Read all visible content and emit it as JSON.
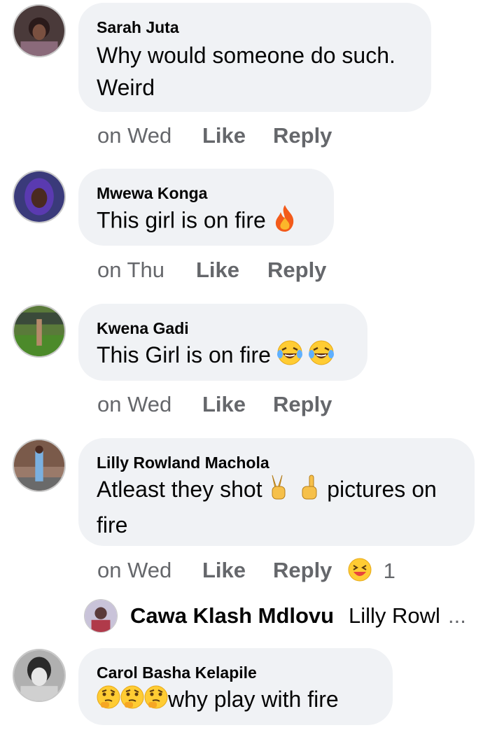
{
  "comments": [
    {
      "author": "Sarah Juta",
      "text_line1": "Why would someone do such.",
      "text_line2": "Weird",
      "time": "on Wed",
      "like": "Like",
      "reply": "Reply"
    },
    {
      "author": "Mwewa Konga",
      "text": "This girl is on fire",
      "emoji": [
        "fire-emoji"
      ],
      "time": "on Thu",
      "like": "Like",
      "reply": "Reply"
    },
    {
      "author": "Kwena Gadi",
      "text": "This Girl is on fire",
      "emoji": [
        "laughing-crying-emoji",
        "laughing-crying-emoji"
      ],
      "time": "on Wed",
      "like": "Like",
      "reply": "Reply"
    },
    {
      "author": "Lilly Rowland Machola",
      "text_part1": "Atleast they shot",
      "text_part2": "pictures on",
      "text_line2": "fire",
      "emoji": [
        "victory-hand-emoji",
        "pointing-up-emoji"
      ],
      "time": "on Wed",
      "like": "Like",
      "reply": "Reply",
      "reaction_emoji": "squinting-laugh-emoji",
      "reaction_count": "1",
      "reply_preview": {
        "name": "Cawa Klash Mdlovu",
        "text": "Lilly Rowl",
        "ellipsis": "..."
      }
    },
    {
      "author": "Carol Basha Kelapile",
      "text": "why play with fire",
      "emoji": [
        "thinking-emoji",
        "thinking-emoji",
        "thinking-emoji"
      ]
    }
  ],
  "colors": {
    "bubble": "#f0f2f5",
    "meta_text": "#65676b",
    "primary_text": "#050505"
  }
}
